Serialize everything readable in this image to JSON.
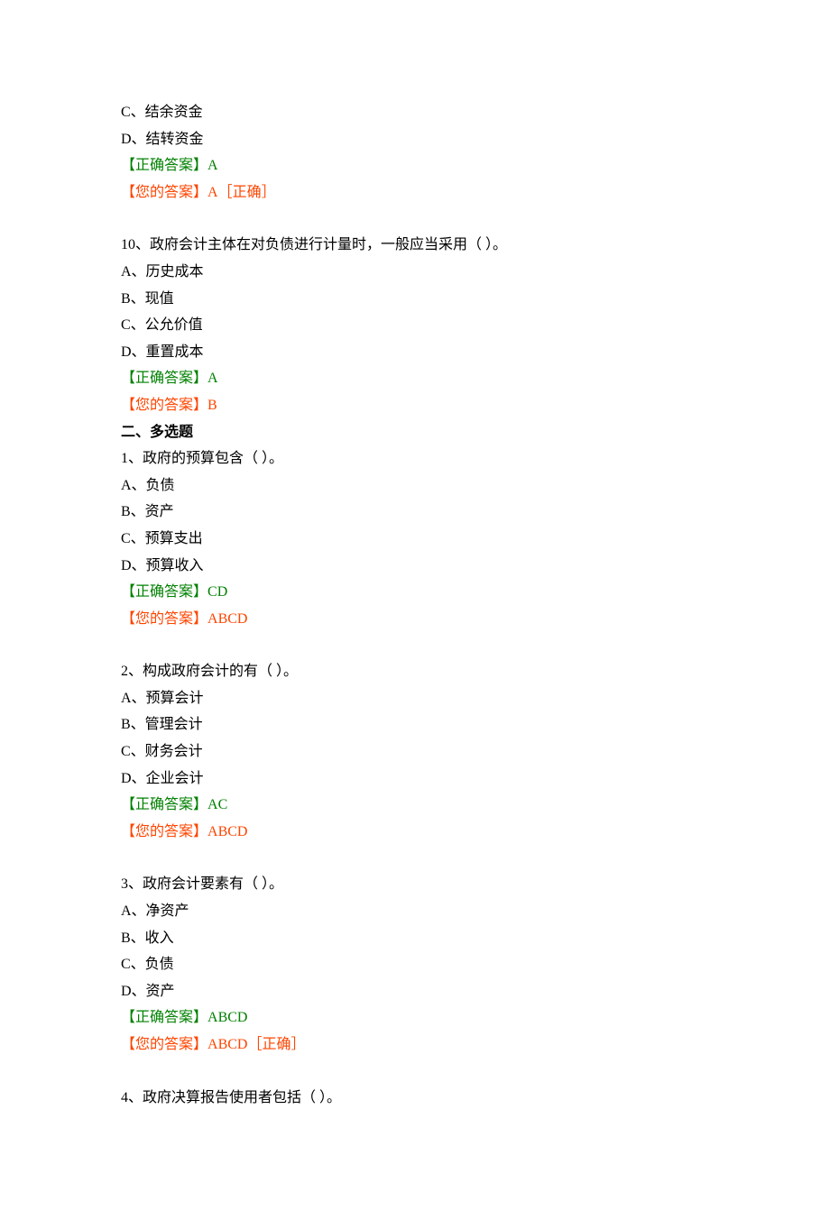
{
  "q9": {
    "optC": "C、结余资金",
    "optD": "D、结转资金",
    "correct_label": "【正确答案】",
    "correct_val": "A",
    "your_label": "【您的答案】",
    "your_val": "A［正确］"
  },
  "q10": {
    "stem": "10、政府会计主体在对负债进行计量时，一般应当采用（ ）。",
    "optA": "A、历史成本",
    "optB": "B、现值",
    "optC": "C、公允价值",
    "optD": "D、重置成本",
    "correct_label": "【正确答案】",
    "correct_val": "A",
    "your_label": "【您的答案】",
    "your_val": "B"
  },
  "section2_heading": "二、多选题",
  "m1": {
    "stem": "1、政府的预算包含（ ）。",
    "optA": "A、负债",
    "optB": "B、资产",
    "optC": "C、预算支出",
    "optD": "D、预算收入",
    "correct_label": "【正确答案】",
    "correct_val": "CD",
    "your_label": "【您的答案】",
    "your_val": "ABCD"
  },
  "m2": {
    "stem": "2、构成政府会计的有（ ）。",
    "optA": "A、预算会计",
    "optB": "B、管理会计",
    "optC": "C、财务会计",
    "optD": "D、企业会计",
    "correct_label": "【正确答案】",
    "correct_val": "AC",
    "your_label": "【您的答案】",
    "your_val": "ABCD"
  },
  "m3": {
    "stem": "3、政府会计要素有（ ）。",
    "optA": "A、净资产",
    "optB": "B、收入",
    "optC": "C、负债",
    "optD": "D、资产",
    "correct_label": "【正确答案】",
    "correct_val": "ABCD",
    "your_label": "【您的答案】",
    "your_val": "ABCD［正确］"
  },
  "m4": {
    "stem": "4、政府决算报告使用者包括（ ）。"
  }
}
